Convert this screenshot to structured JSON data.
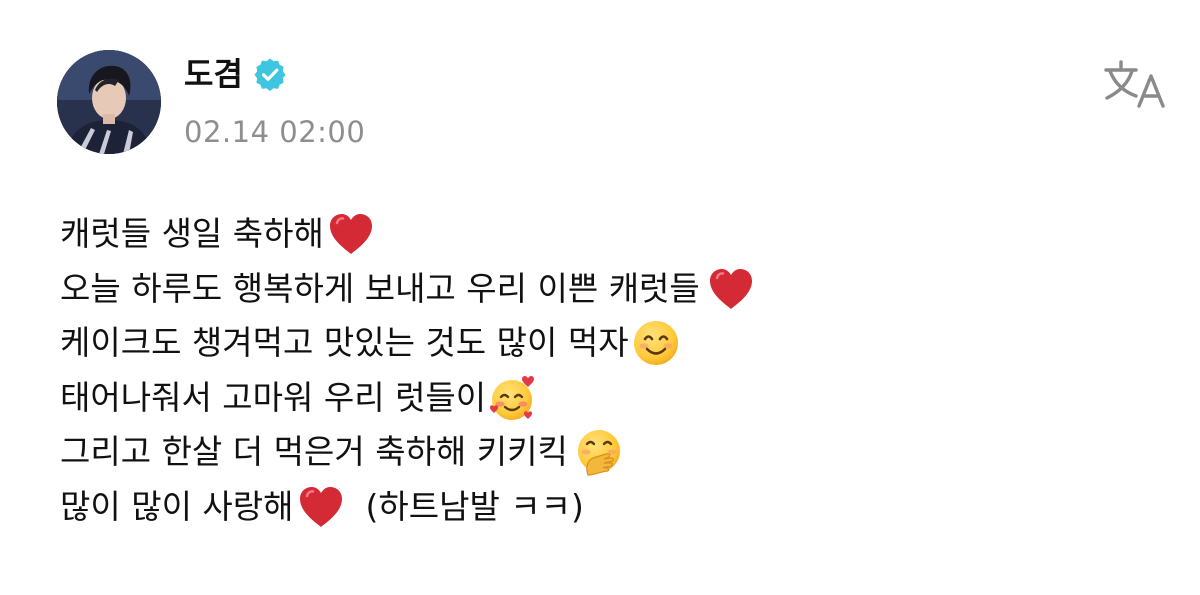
{
  "post": {
    "author": {
      "name": "도겸",
      "verified": true,
      "avatar_icon": "profile-photo"
    },
    "timestamp": "02.14 02:00",
    "translate_icon": "translate-icon",
    "lines": [
      {
        "text": "캐럿들 생일 축하해",
        "emoji": "red-heart"
      },
      {
        "text": "오늘 하루도 행복하게 보내고 우리 이쁜 캐럿들",
        "emoji": "red-heart"
      },
      {
        "text": "케이크도 챙겨먹고 맛있는 것도 많이 먹자",
        "emoji": "smiling-face"
      },
      {
        "text": "태어나줘서 고마워 우리 럿들이",
        "emoji": "smiling-face-with-hearts"
      },
      {
        "text": "그리고 한살 더 먹은거 축하해 키키킥",
        "emoji": "face-with-hand-over-mouth"
      },
      {
        "text": "많이 많이 사랑해",
        "emoji": "red-heart",
        "suffix": "(하트남발 ㅋㅋ)"
      }
    ]
  },
  "colors": {
    "text": "#111111",
    "timestamp": "#8e8e8e",
    "verified_badge": "#3ec6e0",
    "heart": "#d42a35",
    "icon_gray": "#8a8a8a"
  }
}
